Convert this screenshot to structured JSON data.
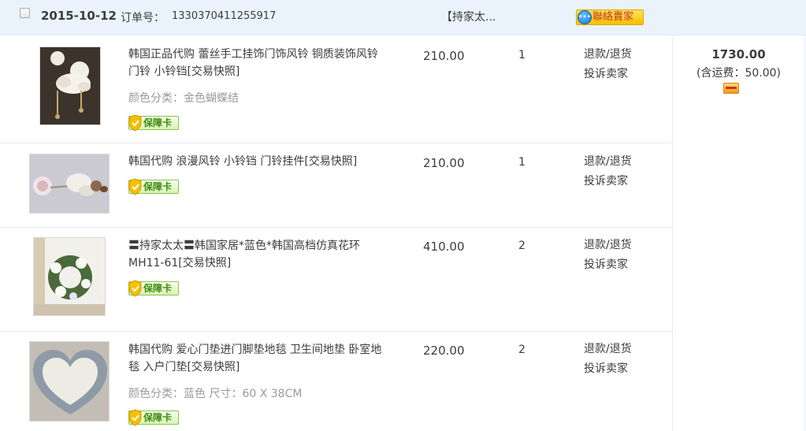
{
  "order": {
    "date": "2015-10-12",
    "order_no_label": "订单号：",
    "order_no": "1330370411255917",
    "shop_name": "【持家太...",
    "contact_label": "聯絡賣家"
  },
  "items": [
    {
      "title": "韩国正品代购 蕾丝手工挂饰门饰风铃 铜质装饰风铃 门铃 小铃铛[交易快照]",
      "attr": "颜色分类：金色蝴蝶结",
      "guarantee": "保障卡",
      "price": "210.00",
      "qty": "1",
      "refund": "退款/退货",
      "complain": "投诉卖家"
    },
    {
      "title": "韩国代购 浪漫风铃 小铃铛 门铃挂件[交易快照]",
      "attr": "",
      "guarantee": "保障卡",
      "price": "210.00",
      "qty": "1",
      "refund": "退款/退货",
      "complain": "投诉卖家"
    },
    {
      "title": "〓持家太太〓韩国家居*蓝色*韩国高档仿真花环MH11-61[交易快照]",
      "attr": "",
      "guarantee": "保障卡",
      "price": "410.00",
      "qty": "2",
      "refund": "退款/退货",
      "complain": "投诉卖家"
    },
    {
      "title": "韩国代购 爱心门垫进门脚垫地毯 卫生间地垫 卧室地毯 入户门垫[交易快照]",
      "attr": "颜色分类：蓝色  尺寸：60 X 38CM",
      "guarantee": "保障卡",
      "price": "220.00",
      "qty": "2",
      "refund": "退款/退货",
      "complain": "投诉卖家"
    }
  ],
  "summary": {
    "total": "1730.00",
    "shipping": "(含运费：50.00)"
  }
}
